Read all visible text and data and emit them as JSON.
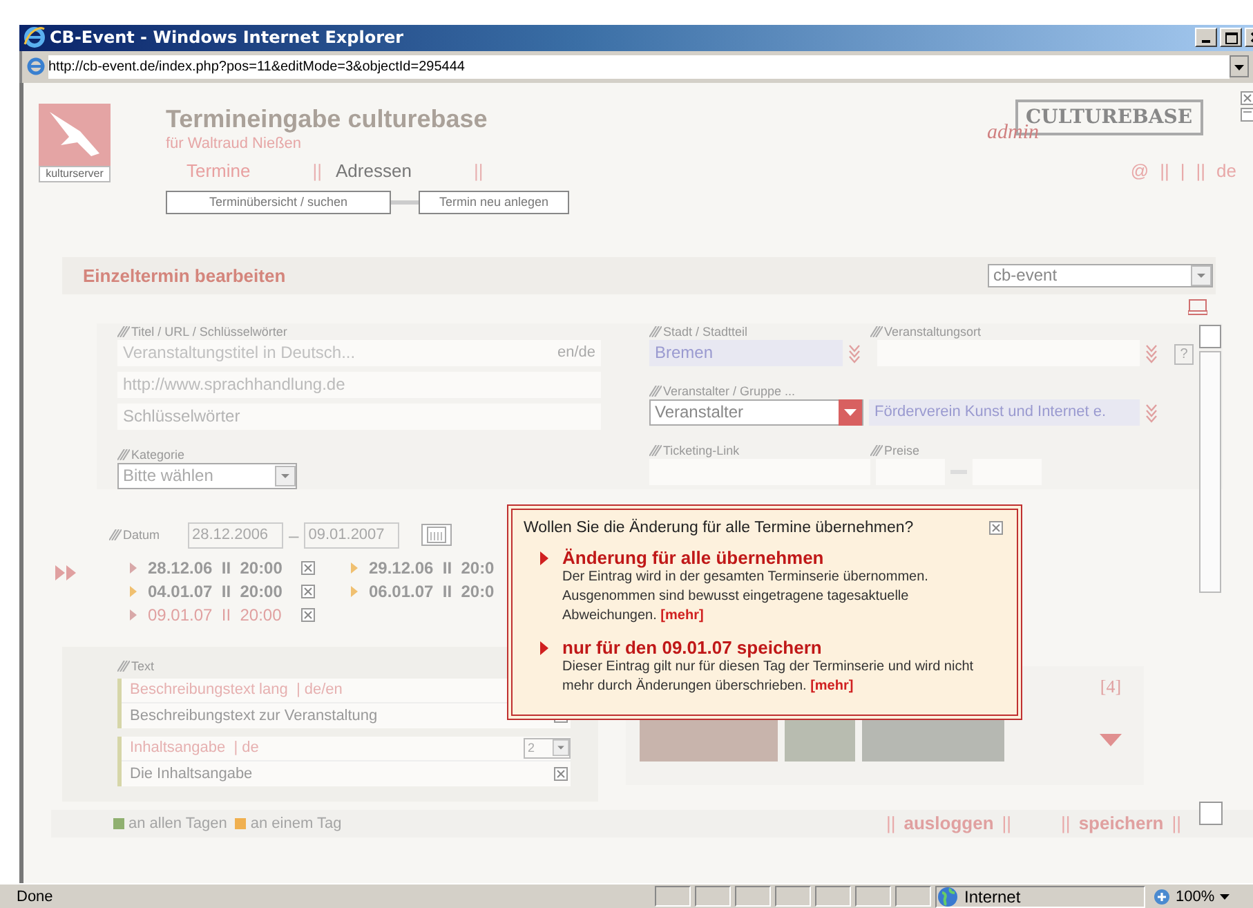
{
  "window": {
    "title": "CB-Event - Windows Internet Explorer",
    "address": "http://cb-event.de/index.php?pos=11&editMode=3&objectId=295444"
  },
  "header": {
    "logo_caption": "kulturserver",
    "title": "Termineingabe culturebase",
    "user": "für  Waltraud Nießen",
    "brand": "CULTUREBASE",
    "brand_script": "admin"
  },
  "nav": {
    "tabs": [
      {
        "label": "Termine",
        "separator": "||",
        "selected": true
      },
      {
        "label": "Adressen",
        "separator": "||",
        "selected": false
      }
    ],
    "right": [
      "@",
      "||",
      "|",
      "||",
      "de"
    ]
  },
  "subtabs": [
    {
      "label": "Terminübersicht / suchen"
    },
    {
      "label": "Termin neu anlegen"
    }
  ],
  "section": {
    "title": "Einzeltermin bearbeiten",
    "portal": "cb-event"
  },
  "form": {
    "title_group": {
      "label": "Titel / URL / Schlüsselwörter",
      "title_placeholder": "Veranstaltungstitel in Deutsch...",
      "lang": "en/de",
      "url": "http://www.sprachhandlung.de",
      "keywords_placeholder": "Schlüsselwörter"
    },
    "category": {
      "label": "Kategorie",
      "value": "Bitte wählen"
    },
    "city": {
      "label": "Stadt / Stadtteil",
      "value": "Bremen"
    },
    "venue": {
      "label": "Veranstaltungsort",
      "help": "?"
    },
    "organizer": {
      "label": "Veranstalter / Gruppe ...",
      "type": "Veranstalter",
      "value": "Förderverein Kunst und Internet e."
    },
    "ticketing": {
      "label": "Ticketing-Link"
    },
    "prices": {
      "label": "Preise"
    },
    "date": {
      "label": "Datum",
      "from": "28.12.2006",
      "dash": "–",
      "to": "09.01.2007"
    }
  },
  "dates": [
    {
      "date": "28.12.06",
      "sep": "II",
      "time": "20:00",
      "selected": false,
      "color": "#d8a8a8"
    },
    {
      "date": "29.12.06",
      "sep": "II",
      "time": "20:0",
      "selected": false,
      "color": "#f0c070"
    },
    {
      "date": "04.01.07",
      "sep": "II",
      "time": "20:00",
      "selected": false,
      "color": "#f0c070"
    },
    {
      "date": "06.01.07",
      "sep": "II",
      "time": "20:0",
      "selected": false,
      "color": "#f0c070"
    },
    {
      "date": "09.01.07",
      "sep": "II",
      "time": "20:00",
      "selected": true,
      "color": "#d8a8a8"
    }
  ],
  "texts": {
    "label": "Text",
    "items": [
      {
        "title": "Beschreibungstext lang",
        "lang": "| de/en",
        "value": "Beschreibungstext zur Veranstaltung"
      },
      {
        "title": "Inhaltsangabe",
        "lang": "| de",
        "value": "Die Inhaltsangabe",
        "count": "2"
      }
    ]
  },
  "media": {
    "count": "[4]",
    "photos": [
      {
        "kind": "photo"
      },
      {
        "kind": "photo"
      },
      {
        "kind": "photo"
      }
    ]
  },
  "legend": [
    {
      "label": "an allen Tagen",
      "color": "#90b070"
    },
    {
      "label": "an einem Tag",
      "color": "#f0b050"
    }
  ],
  "actions": [
    {
      "label": "ausloggen",
      "separator": "||"
    },
    {
      "label": "speichern",
      "separator": "||"
    }
  ],
  "dialog": {
    "question": "Wollen Sie die Änderung für alle Termine übernehmen?",
    "options": [
      {
        "title": "Änderung für alle übernehmen",
        "text": "Der Eintrag wird in der gesamten Terminserie übernommen. Ausgenommen sind bewusst eingetragene tagesaktuelle Abweichungen.",
        "more": "[mehr]"
      },
      {
        "title": "nur für den 09.01.07 speichern",
        "text": "Dieser Eintrag gilt nur für diesen Tag der Terminserie und wird nicht mehr durch Änderungen überschrieben.",
        "more": "[mehr]"
      }
    ]
  },
  "status_bar": {
    "text": "Done",
    "zone": "Internet",
    "zoom": "100%"
  }
}
